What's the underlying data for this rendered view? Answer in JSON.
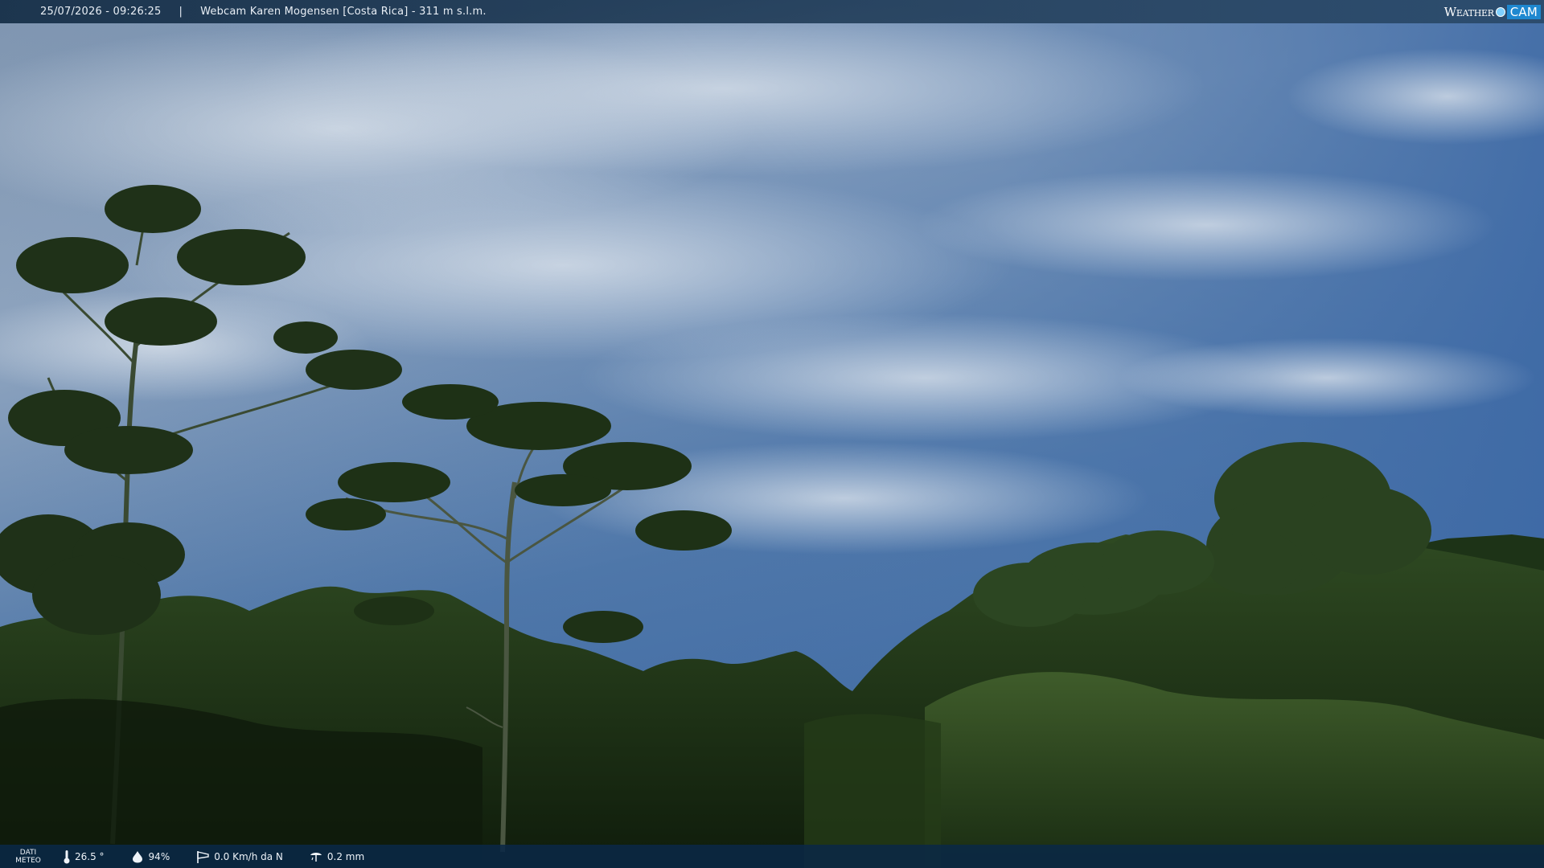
{
  "header": {
    "datetime": "25/07/2026 - 09:26:25",
    "separator": "|",
    "title": "Webcam Karen Mogensen [Costa Rica] - 311 m s.l.m.",
    "logo_left": "Weather",
    "logo_right": "CAM"
  },
  "footer": {
    "label_line1": "DATI",
    "label_line2": "METEO",
    "temperature": "26.5 °",
    "humidity": "94%",
    "wind": "0.0 Km/h da N",
    "rain": "0.2 mm"
  },
  "icons": {
    "temperature": "thermometer-icon",
    "humidity": "drop-icon",
    "wind": "windsock-icon",
    "rain": "rain-gauge-icon"
  },
  "colors": {
    "sky_top": "#4f6f97",
    "sky_mid": "#7a93b3",
    "cloud": "#cdd6e0",
    "forest_dark": "#142410",
    "forest_mid": "#2c4520",
    "bar": "#142d46"
  }
}
